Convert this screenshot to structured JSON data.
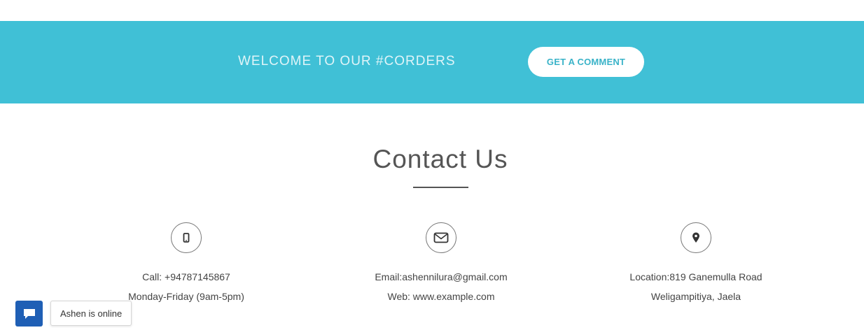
{
  "banner": {
    "text": "WELCOME TO OUR #CORDERS",
    "button_label": "GET A COMMENT",
    "background_color": "#40c0d6"
  },
  "contact": {
    "title": "Contact Us",
    "columns": [
      {
        "icon": "mobile-phone-icon",
        "line1": "Call: +94787145867",
        "line2": "Monday-Friday (9am-5pm)"
      },
      {
        "icon": "envelope-icon",
        "line1": "Email:ashennilura@gmail.com",
        "line2": "Web: www.example.com"
      },
      {
        "icon": "map-marker-icon",
        "line1": "Location:819 Ganemulla Road",
        "line2": "Weligampitiya, Jaela"
      }
    ]
  },
  "chat_widget": {
    "icon": "chat-bubble-icon",
    "status_text": "Ashen is online",
    "color": "#1f5fb5"
  }
}
